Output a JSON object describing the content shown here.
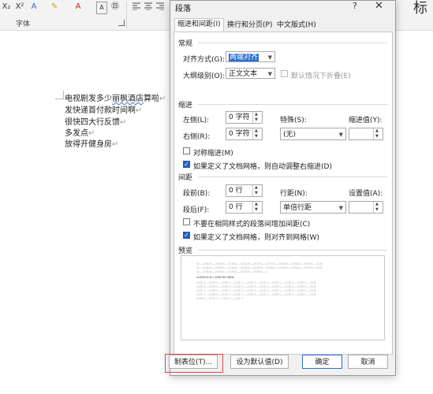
{
  "ribbon": {
    "subscript": "X₂",
    "superscript": "X²",
    "text_effects": "A",
    "highlight": "✎",
    "font_color": "A",
    "clear": "A",
    "phonetic": "㊐",
    "font_group_label": "字体",
    "right_fragment": "标"
  },
  "document": {
    "lines": [
      {
        "before": "电视剧发多少",
        "wavy": "丽枫酒店",
        "after": "算啦",
        "mark": "↵"
      },
      {
        "before": "发快递首付款时间啊",
        "wavy": "",
        "after": "",
        "mark": "↵"
      },
      {
        "before": "很快四大行反馈",
        "wavy": "",
        "after": "",
        "mark": "↵"
      },
      {
        "before": "多发点",
        "wavy": "",
        "after": "",
        "mark": "↵"
      },
      {
        "before": "放得开健身房",
        "wavy": "",
        "after": "",
        "mark": "↵"
      }
    ]
  },
  "dialog": {
    "title": "段落",
    "help": "?",
    "close": "✕",
    "tabs": [
      {
        "label": "缩进和间距(I)",
        "active": true
      },
      {
        "label": "换行和分页(P)",
        "active": false
      },
      {
        "label": "中文版式(H)",
        "active": false
      }
    ],
    "general": {
      "heading": "常规",
      "alignment_label": "对齐方式(G):",
      "alignment_value": "两端对齐",
      "outline_label": "大纲级别(O):",
      "outline_value": "正文文本",
      "collapse_label": "默认情况下折叠(E)"
    },
    "indent": {
      "heading": "缩进",
      "left_label": "左侧(L):",
      "left_value": "0 字符",
      "right_label": "右侧(R):",
      "right_value": "0 字符",
      "special_label": "特殊(S):",
      "special_value": "(无)",
      "indent_by_label": "缩进值(Y):",
      "indent_by_value": "",
      "mirror_label": "对称缩进(M)",
      "auto_adjust_label": "如果定义了文档网格，则自动调整右缩进(D)"
    },
    "spacing": {
      "heading": "间距",
      "before_label": "段前(B):",
      "before_value": "0 行",
      "after_label": "段后(F):",
      "after_value": "0 行",
      "line_label": "行距(N):",
      "line_value": "单倍行距",
      "at_label": "设置值(A):",
      "at_value": "",
      "no_space_label": "不要在相同样式的段落间增加间距(C)",
      "snap_grid_label": "如果定义了文档网格，则对齐到网格(W)"
    },
    "preview": {
      "heading": "预览",
      "prev_text": "前一段落前一段落前一段落前一段落前一段落前一段落前一段落前一段落前一段落前一段落",
      "sample_text": "电视剧发多少丽枫酒店算啦",
      "next_text": "段落下一段落下一段落下一段落下一段落下一段落下一段落下一段落下一段落下一段落"
    },
    "buttons": {
      "tabs": "制表位(T)...",
      "default": "设为默认值(D)",
      "ok": "确定",
      "cancel": "取消"
    },
    "colors": {
      "accent": "#2b6fcf",
      "highlight_box": "#e04646"
    }
  }
}
